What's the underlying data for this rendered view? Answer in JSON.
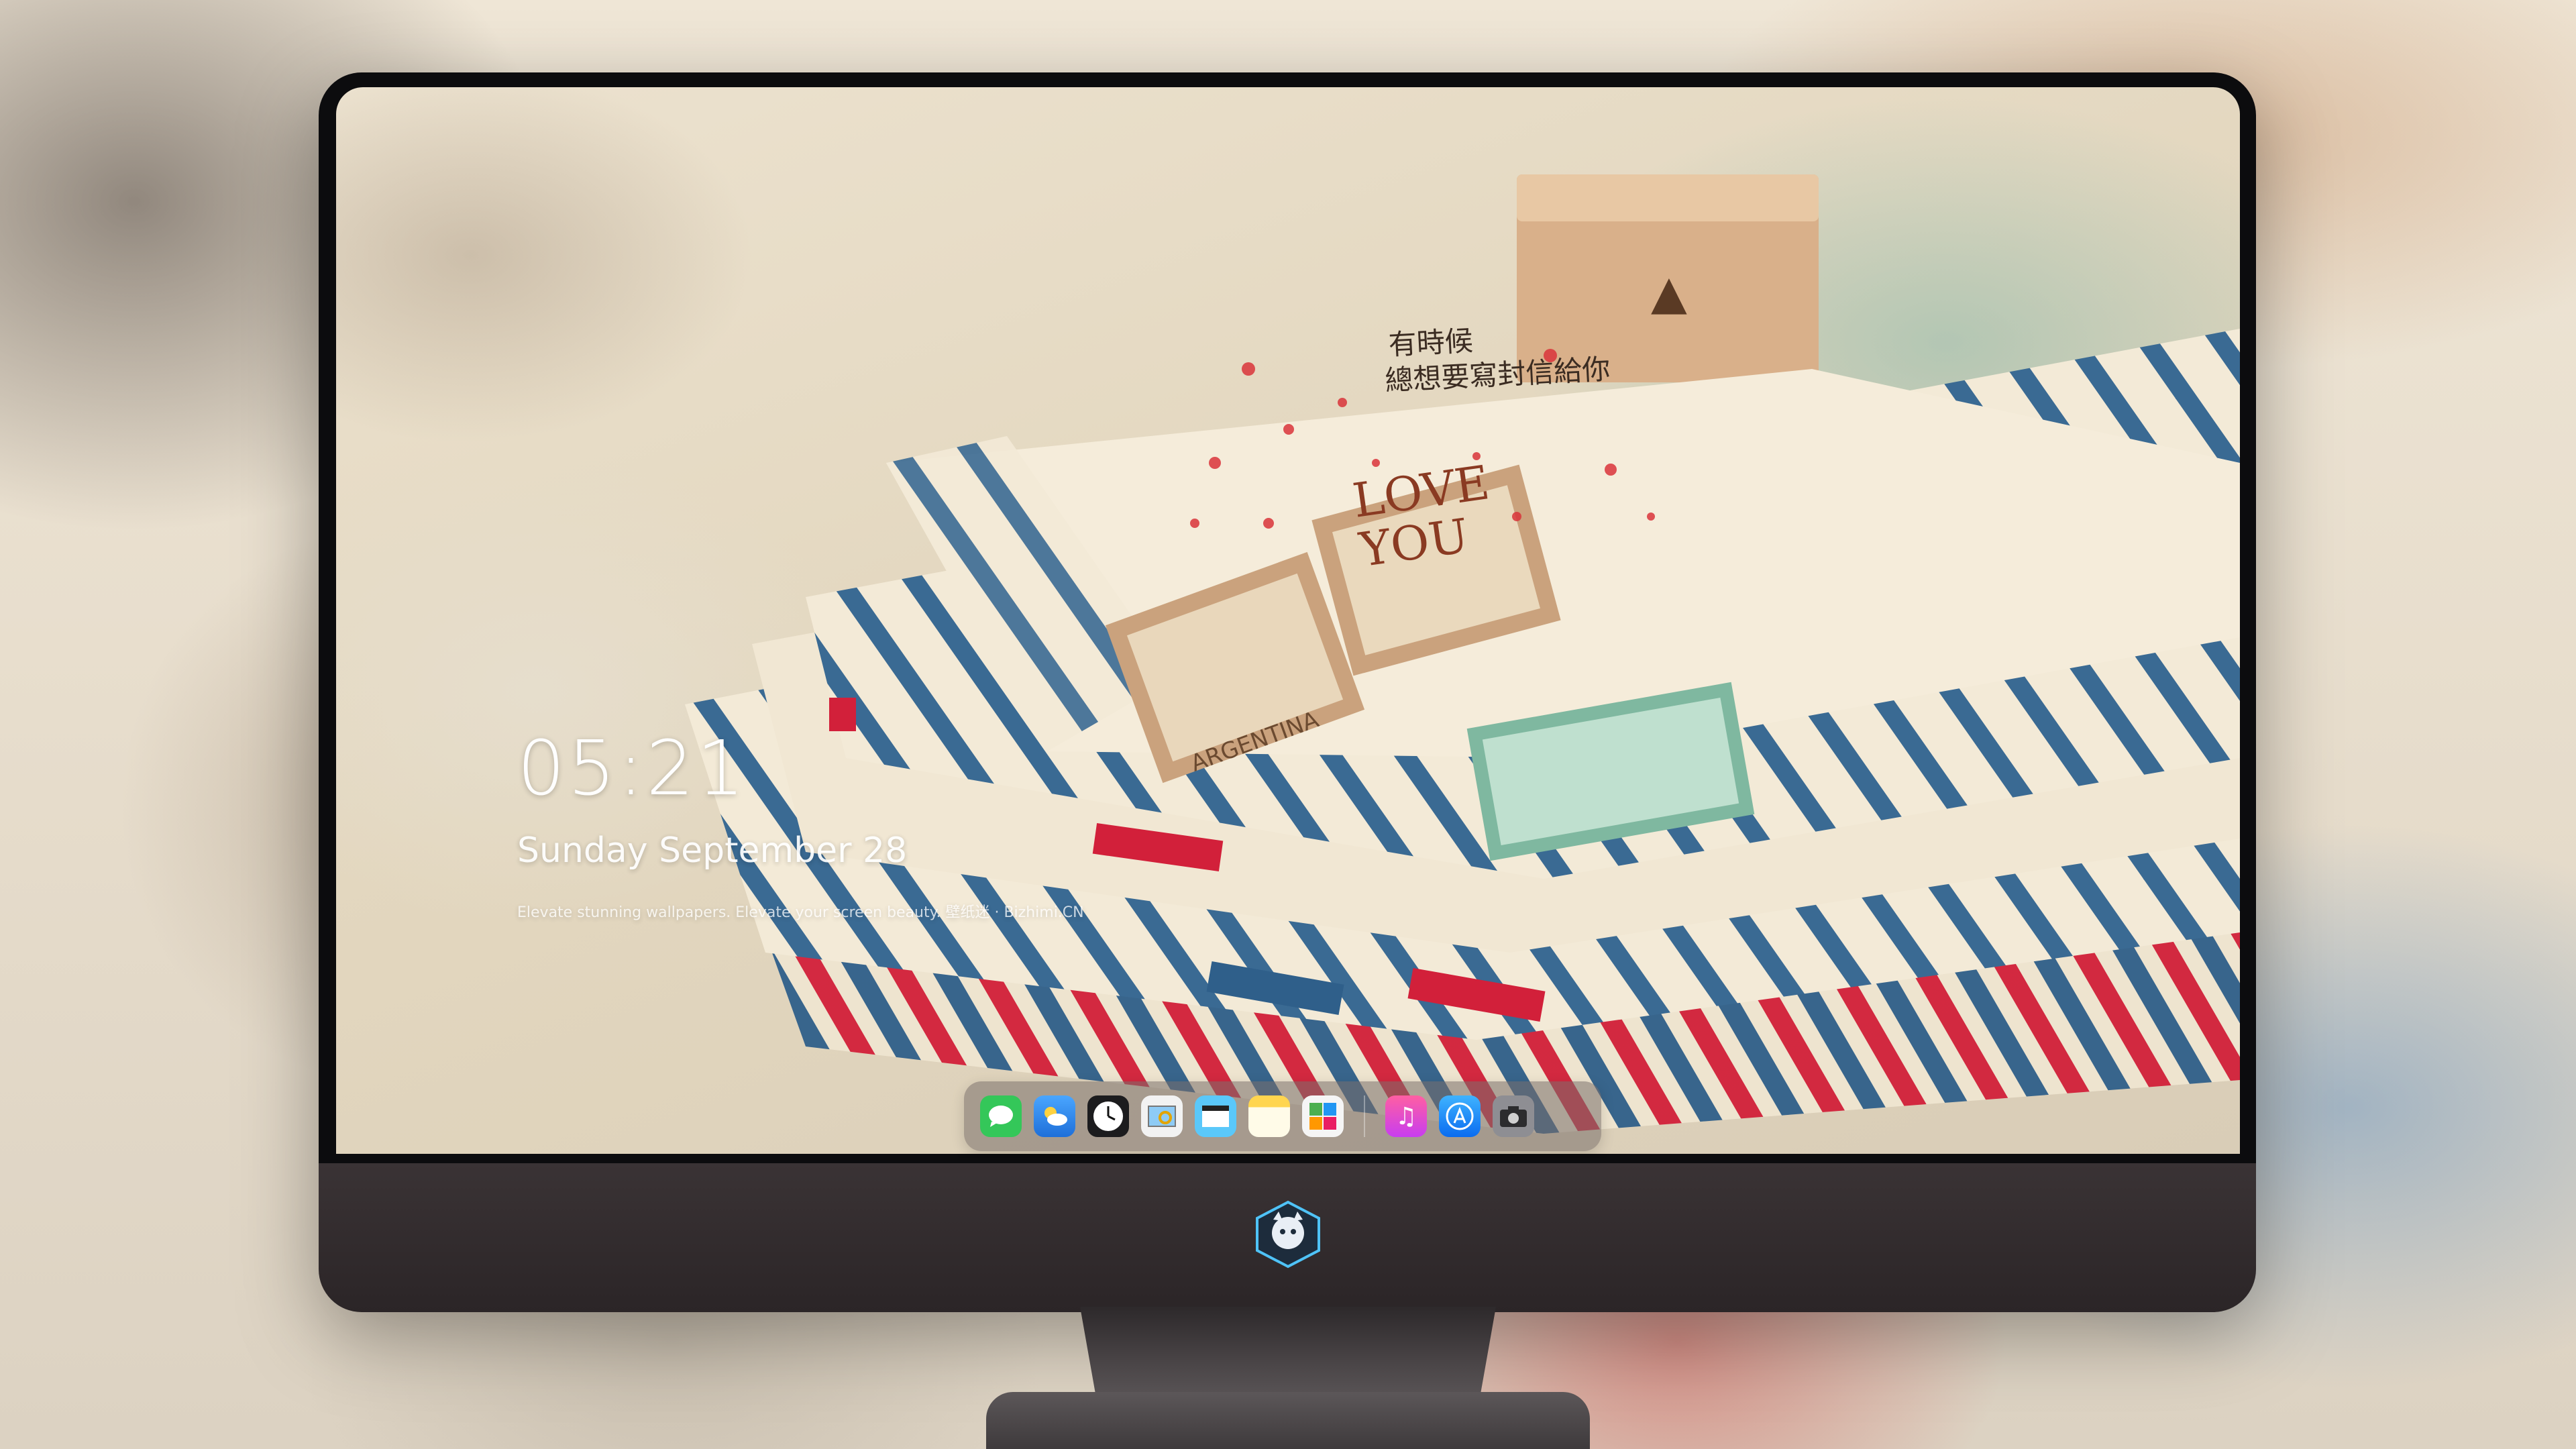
{
  "lock_screen": {
    "time": "05:21",
    "date": "Sunday September  28",
    "tagline": "Elevate stunning wallpapers. Elevate your screen beauty. 壁纸迷 · Bizhimi.CN"
  },
  "wallpaper": {
    "handwriting_line1": "有時候",
    "handwriting_line2": "總想要寫封信給你",
    "stamp_text": "LOVE YOU",
    "stamp_label": "ARGENTINA"
  },
  "dock": {
    "apps": [
      {
        "name": "messages-icon",
        "color": "#34c759"
      },
      {
        "name": "weather-icon",
        "color": "#1e90ff"
      },
      {
        "name": "clock-icon",
        "color": "#ffffff"
      },
      {
        "name": "preview-icon",
        "color": "#f5c542"
      },
      {
        "name": "clips-icon",
        "color": "#5ac8fa"
      },
      {
        "name": "notes-icon",
        "color": "#ffd54f"
      },
      {
        "name": "photo-booth-icon",
        "color": "#4caf50"
      },
      {
        "name": "music-icon",
        "color": "#ff3b8d"
      },
      {
        "name": "app-store-icon",
        "color": "#1a8cff"
      },
      {
        "name": "camera-icon",
        "color": "#8e8e93"
      }
    ]
  },
  "colors": {
    "bezel": "#0c0c0e",
    "chin": "#332d2f",
    "airmail_blue": "#2f5f8a",
    "airmail_red": "#d2203a"
  }
}
